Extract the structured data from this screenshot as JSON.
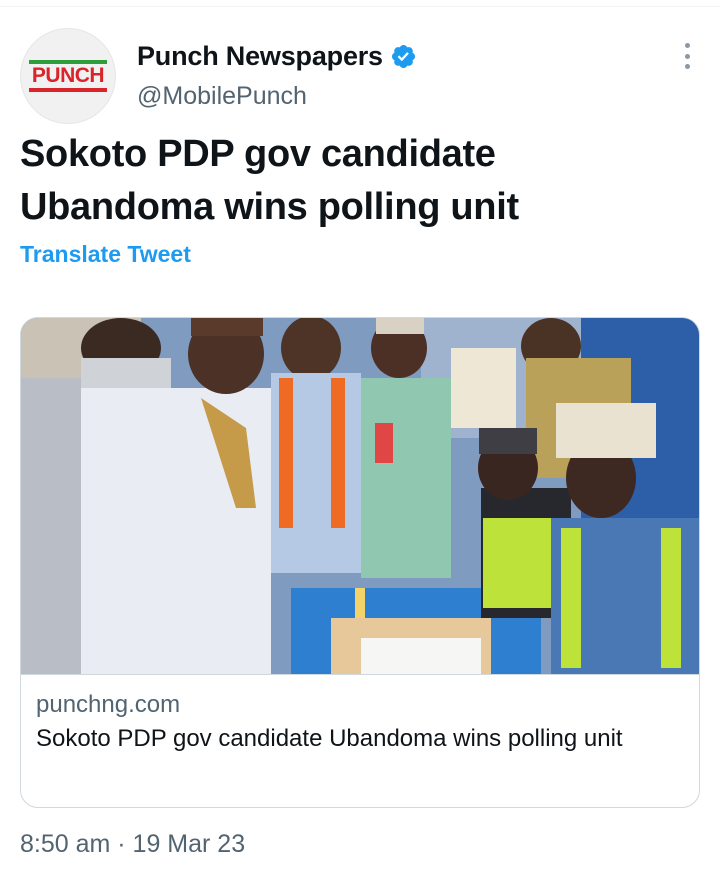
{
  "tweet": {
    "author": {
      "display_name": "Punch Newspapers",
      "handle": "@MobilePunch",
      "verified": true,
      "avatar_logo_text": "PUNCH"
    },
    "text": "Sokoto PDP gov candidate Ubandoma wins polling unit",
    "translate_label": "Translate Tweet",
    "link_card": {
      "domain": "punchng.com",
      "title": "Sokoto PDP gov candidate Ubandoma wins polling unit",
      "image_icon": "news-photo"
    },
    "timestamp": "8:50 am · 19 Mar 23"
  },
  "colors": {
    "accent": "#1d9bf0",
    "text_primary": "#0f1419",
    "text_secondary": "#536471",
    "brand_red": "#d9242a",
    "brand_green": "#2e9e3a"
  },
  "icons": [
    "verified-badge-icon",
    "more-options-icon"
  ]
}
